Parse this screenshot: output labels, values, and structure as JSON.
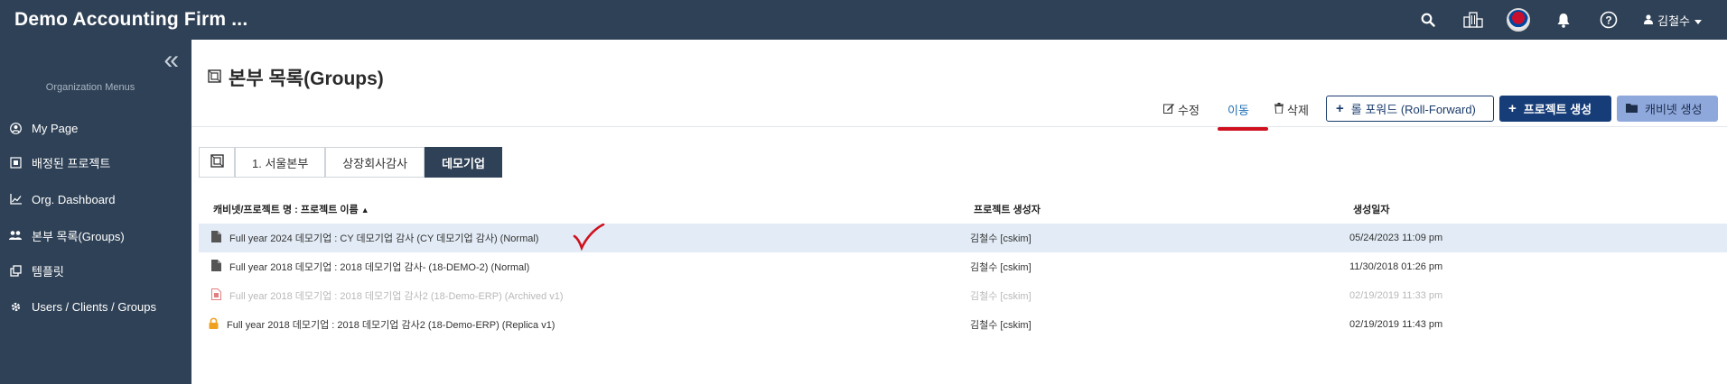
{
  "app": {
    "brand": "Demo Accounting Firm ...",
    "user": "김철수"
  },
  "header_icons": [
    "search-icon",
    "building-icon",
    "language-flag-icon",
    "bell-icon",
    "help-icon"
  ],
  "sidebar": {
    "section_label": "Organization Menus",
    "items": [
      {
        "label": "My Page",
        "icon": "user-circle-icon"
      },
      {
        "label": "배정된 프로젝트",
        "icon": "assigned-icon"
      },
      {
        "label": "Org. Dashboard",
        "icon": "chart-icon"
      },
      {
        "label": "본부 목록(Groups)",
        "icon": "users-icon"
      },
      {
        "label": "템플릿",
        "icon": "template-icon"
      },
      {
        "label": "Users / Clients / Groups",
        "icon": "gear-icon"
      }
    ]
  },
  "page": {
    "title": "본부 목록(Groups)",
    "actions": {
      "edit": "수정",
      "move": "이동",
      "delete": "삭제",
      "roll_forward": "롤 포워드 (Roll-Forward)",
      "create_project": "프로젝트 생성",
      "create_cabinet": "캐비넷 생성"
    },
    "breadcrumb": [
      "1. 서울본부",
      "상장회사감사",
      "데모기업"
    ]
  },
  "table": {
    "columns": [
      "캐비넷/프로젝트 명 : 프로젝트 이름",
      "프로젝트 생성자",
      "생성일자"
    ],
    "rows": [
      {
        "name": "Full year 2024 데모기업 : CY 데모기업 감사 (CY 데모기업 감사) (Normal)",
        "creator": "김철수 [cskim]",
        "date": "05/24/2023 11:09 pm",
        "icon": "file-icon",
        "state": "selected"
      },
      {
        "name": "Full year 2018 데모기업 : 2018 데모기업 감사- (18-DEMO-2) (Normal)",
        "creator": "김철수 [cskim]",
        "date": "11/30/2018 01:26 pm",
        "icon": "file-icon",
        "state": "normal"
      },
      {
        "name": "Full year 2018 데모기업 : 2018 데모기업 감사2 (18-Demo-ERP) (Archived v1)",
        "creator": "김철수 [cskim]",
        "date": "02/19/2019 11:33 pm",
        "icon": "archive-file-icon",
        "state": "archived"
      },
      {
        "name": "Full year 2018 데모기업 : 2018 데모기업 감사2 (18-Demo-ERP) (Replica v1)",
        "creator": "김철수 [cskim]",
        "date": "02/19/2019 11:43 pm",
        "icon": "lock-icon",
        "state": "normal"
      }
    ]
  },
  "colors": {
    "nav_bg": "#2f4156",
    "primary": "#173d78",
    "annotation_red": "#d0101e",
    "selected_row": "#e3ecf6"
  }
}
